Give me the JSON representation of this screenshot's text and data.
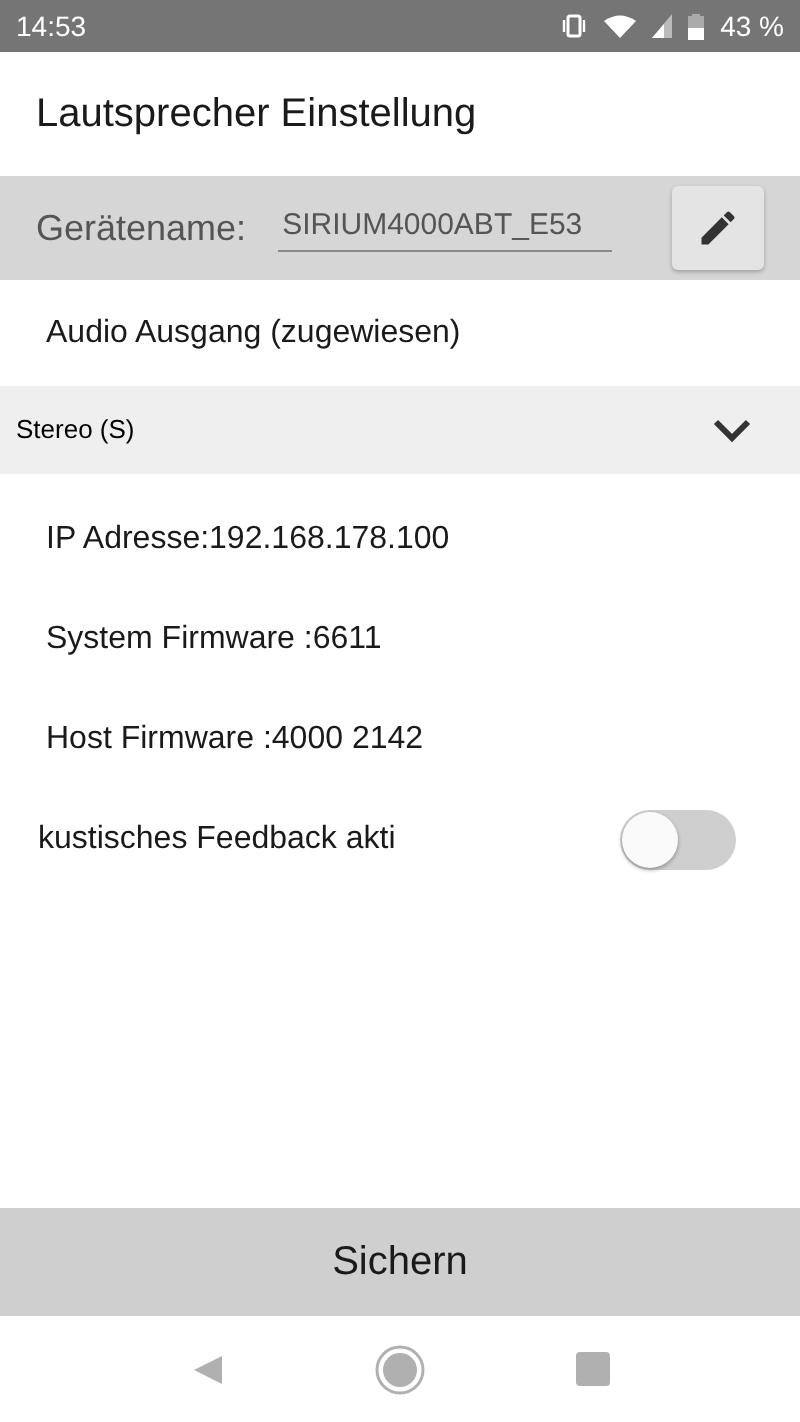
{
  "status_bar": {
    "time": "14:53",
    "battery_text": "43 %"
  },
  "title": "Lautsprecher Einstellung",
  "device_name": {
    "label": "Gerätename:",
    "value": "SIRIUM4000ABT_E53"
  },
  "audio_output": {
    "label": "Audio Ausgang (zugewiesen)",
    "selected_option": "Stereo (S)"
  },
  "info_rows": [
    {
      "kind": "text",
      "label": "IP Adresse:192.168.178.100"
    },
    {
      "kind": "text",
      "label": "System Firmware :6611"
    },
    {
      "kind": "text",
      "label": "Host Firmware :4000 2142"
    },
    {
      "kind": "toggle",
      "label": "kustisches Feedback akti",
      "on": false
    }
  ],
  "save_button": "Sichern"
}
